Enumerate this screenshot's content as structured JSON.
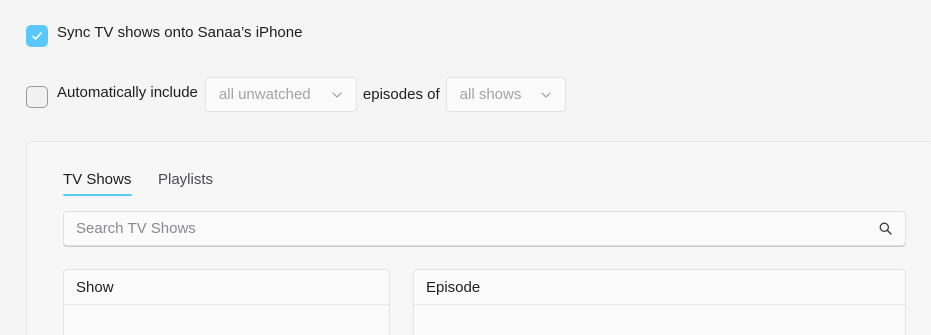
{
  "sync": {
    "label": "Sync TV shows onto Sanaa’s iPhone",
    "checked": true
  },
  "auto_include": {
    "label": "Automatically include",
    "checked": false,
    "episodes_select": {
      "value": "all unwatched",
      "icon": "chevron-down-icon"
    },
    "connector": "episodes of",
    "shows_select": {
      "value": "all shows",
      "icon": "chevron-down-icon"
    }
  },
  "tabs": [
    {
      "label": "TV Shows",
      "active": true
    },
    {
      "label": "Playlists",
      "active": false
    }
  ],
  "search": {
    "placeholder": "Search TV Shows",
    "icon": "search-icon"
  },
  "tables": {
    "show": {
      "header": "Show"
    },
    "episode": {
      "header": "Episode"
    }
  },
  "colors": {
    "accent": "#5ac8fa",
    "background": "#f5f5f6"
  }
}
